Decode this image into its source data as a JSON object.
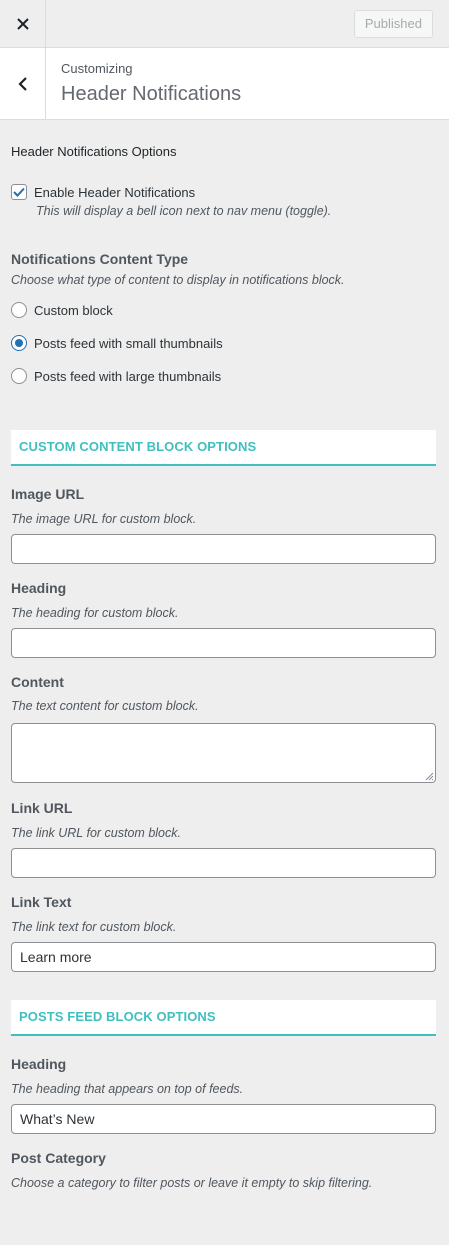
{
  "topbar": {
    "close_icon": "close-icon",
    "published_label": "Published"
  },
  "section_header": {
    "back_icon": "chevron-left-icon",
    "customizing_label": "Customizing",
    "title": "Header Notifications"
  },
  "options": {
    "title": "Header Notifications Options",
    "enable": {
      "label": "Enable Header Notifications",
      "description": "This will display a bell icon next to nav menu (toggle).",
      "checked": true
    },
    "content_type": {
      "title": "Notifications Content Type",
      "description": "Choose what type of content to display in notifications block.",
      "choices": [
        {
          "label": "Custom block",
          "selected": false
        },
        {
          "label": "Posts feed with small thumbnails",
          "selected": true
        },
        {
          "label": "Posts feed with large thumbnails",
          "selected": false
        }
      ]
    }
  },
  "custom_block": {
    "heading": "CUSTOM CONTENT BLOCK OPTIONS",
    "image_url": {
      "title": "Image URL",
      "description": "The image URL for custom block.",
      "value": ""
    },
    "heading_field": {
      "title": "Heading",
      "description": "The heading for custom block.",
      "value": ""
    },
    "content": {
      "title": "Content",
      "description": "The text content for custom block.",
      "value": ""
    },
    "link_url": {
      "title": "Link URL",
      "description": "The link URL for custom block.",
      "value": ""
    },
    "link_text": {
      "title": "Link Text",
      "description": "The link text for custom block.",
      "value": "Learn more"
    }
  },
  "posts_feed": {
    "heading": "POSTS FEED BLOCK OPTIONS",
    "heading_field": {
      "title": "Heading",
      "description": "The heading that appears on top of feeds.",
      "value": "What’s New"
    },
    "post_category": {
      "title": "Post Category",
      "description": "Choose a category to filter posts or leave it empty to skip filtering.",
      "value": ""
    }
  },
  "colors": {
    "accent": "#40bfbf",
    "checkbox": "#2271b1"
  }
}
